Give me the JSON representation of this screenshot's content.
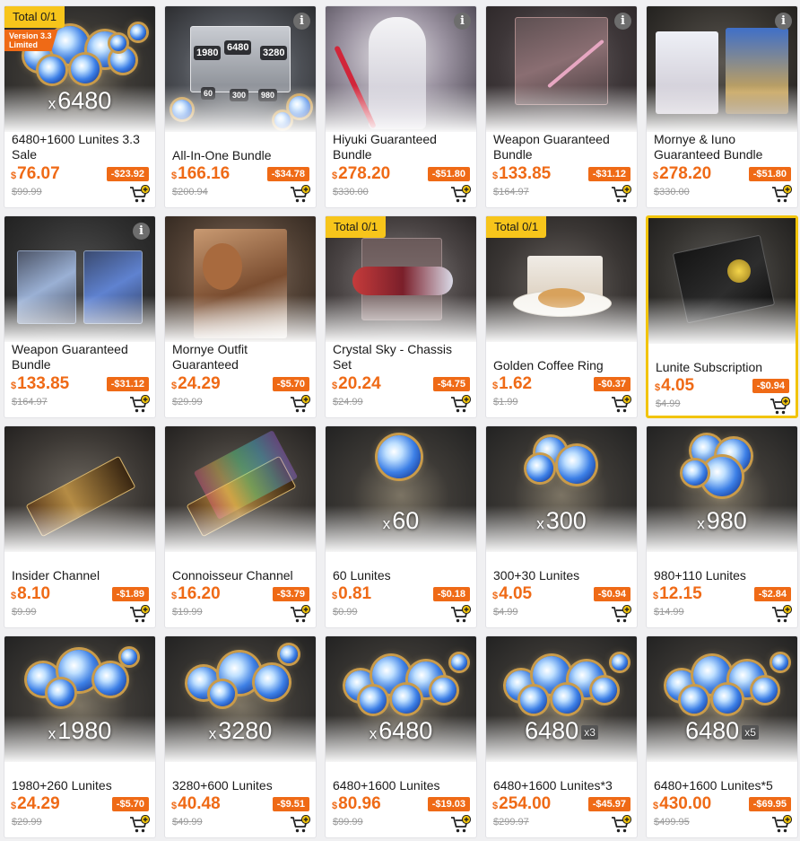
{
  "colors": {
    "accent": "#ef6a16",
    "badge": "#f7c51b",
    "selected_border": "#f2c40a",
    "original_price": "#9a9a9a"
  },
  "products": [
    {
      "name": "6480+1600 Lunites 3.3 Sale",
      "currency": "$",
      "price": "76.07",
      "discount": "-$23.92",
      "original": "$99.99",
      "badge": "Total 0/1",
      "limited": [
        "Version 3.3",
        "Limited"
      ],
      "quantity": "6480",
      "quantity_prefix": "x",
      "info": false,
      "art": "lunite-pile-large",
      "selected": false
    },
    {
      "name": "All-In-One Bundle",
      "currency": "$",
      "price": "166.16",
      "discount": "-$34.78",
      "original": "$200.94",
      "info": true,
      "art": "all-in-one-box",
      "art_labels": [
        "1980",
        "6480",
        "3280",
        "60",
        "300",
        "980"
      ],
      "selected": false
    },
    {
      "name": "Hiyuki Guaranteed Bundle",
      "currency": "$",
      "price": "278.20",
      "discount": "-$51.80",
      "original": "$330.00",
      "info": true,
      "art": "character-hiyuki",
      "selected": false
    },
    {
      "name": "Weapon Guaranteed Bundle",
      "currency": "$",
      "price": "133.85",
      "discount": "-$31.12",
      "original": "$164.97",
      "info": true,
      "art": "weapon-card",
      "selected": false
    },
    {
      "name": "Mornye & Iuno Guaranteed Bundle",
      "currency": "$",
      "price": "278.20",
      "discount": "-$51.80",
      "original": "$330.00",
      "info": true,
      "art": "two-characters",
      "selected": false
    },
    {
      "name": "Weapon Guaranteed Bundle",
      "currency": "$",
      "price": "133.85",
      "discount": "-$31.12",
      "original": "$164.97",
      "info": true,
      "art": "two-weapons",
      "selected": false
    },
    {
      "name": "Mornye Outfit Guaranteed",
      "currency": "$",
      "price": "24.29",
      "discount": "-$5.70",
      "original": "$29.99",
      "info": false,
      "art": "outfit-teddy",
      "selected": false
    },
    {
      "name": "Crystal Sky - Chassis Set",
      "currency": "$",
      "price": "20.24",
      "discount": "-$4.75",
      "original": "$24.99",
      "badge": "Total 0/1",
      "info": false,
      "art": "motorbike",
      "selected": false
    },
    {
      "name": "Golden Coffee Ring",
      "currency": "$",
      "price": "1.62",
      "discount": "-$0.37",
      "original": "$1.99",
      "badge": "Total 0/1",
      "info": false,
      "art": "coffee-plate",
      "selected": false
    },
    {
      "name": "Lunite Subscription",
      "currency": "$",
      "price": "4.05",
      "discount": "-$0.94",
      "original": "$4.99",
      "info": false,
      "art": "subscription-card",
      "selected": true
    },
    {
      "name": "Insider Channel",
      "currency": "$",
      "price": "8.10",
      "discount": "-$1.89",
      "original": "$9.99",
      "info": false,
      "art": "chip-gold",
      "selected": false
    },
    {
      "name": "Connoisseur Channel",
      "currency": "$",
      "price": "16.20",
      "discount": "-$3.79",
      "original": "$19.99",
      "info": false,
      "art": "chip-rainbow",
      "selected": false
    },
    {
      "name": "60 Lunites",
      "currency": "$",
      "price": "0.81",
      "discount": "-$0.18",
      "original": "$0.99",
      "quantity": "60",
      "quantity_prefix": "x",
      "info": false,
      "art": "lunite-1",
      "selected": false
    },
    {
      "name": "300+30 Lunites",
      "currency": "$",
      "price": "4.05",
      "discount": "-$0.94",
      "original": "$4.99",
      "quantity": "300",
      "quantity_prefix": "x",
      "info": false,
      "art": "lunite-3",
      "selected": false
    },
    {
      "name": "980+110 Lunites",
      "currency": "$",
      "price": "12.15",
      "discount": "-$2.84",
      "original": "$14.99",
      "quantity": "980",
      "quantity_prefix": "x",
      "info": false,
      "art": "lunite-4",
      "selected": false
    },
    {
      "name": "1980+260 Lunites",
      "currency": "$",
      "price": "24.29",
      "discount": "-$5.70",
      "original": "$29.99",
      "quantity": "1980",
      "quantity_prefix": "x",
      "info": false,
      "art": "lunite-5",
      "selected": false
    },
    {
      "name": "3280+600 Lunites",
      "currency": "$",
      "price": "40.48",
      "discount": "-$9.51",
      "original": "$49.99",
      "quantity": "3280",
      "quantity_prefix": "x",
      "info": false,
      "art": "lunite-6",
      "selected": false
    },
    {
      "name": "6480+1600 Lunites",
      "currency": "$",
      "price": "80.96",
      "discount": "-$19.03",
      "original": "$99.99",
      "quantity": "6480",
      "quantity_prefix": "x",
      "info": false,
      "art": "lunite-pile-large",
      "selected": false
    },
    {
      "name": "6480+1600 Lunites*3",
      "currency": "$",
      "price": "254.00",
      "discount": "-$45.97",
      "original": "$299.97",
      "quantity": "6480",
      "multiplier": "x3",
      "info": false,
      "art": "lunite-pile-large",
      "selected": false
    },
    {
      "name": "6480+1600 Lunites*5",
      "currency": "$",
      "price": "430.00",
      "discount": "-$69.95",
      "original": "$499.95",
      "quantity": "6480",
      "multiplier": "x5",
      "info": false,
      "art": "lunite-pile-large",
      "selected": false
    }
  ]
}
